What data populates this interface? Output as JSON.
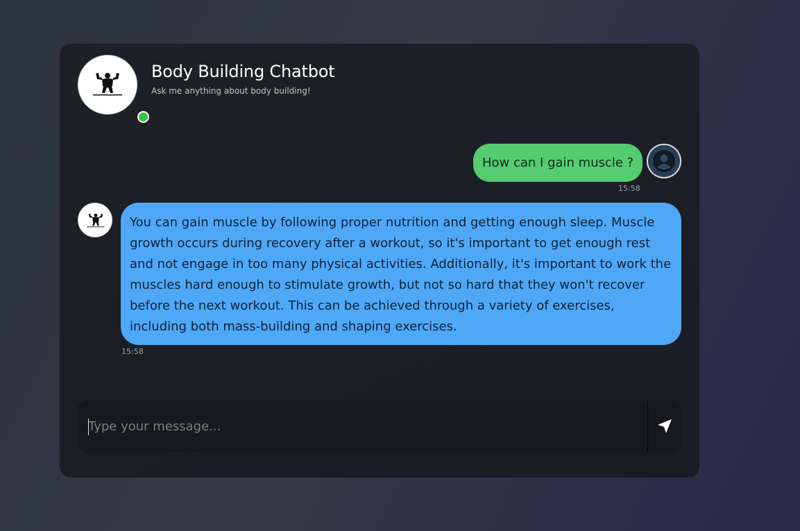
{
  "header": {
    "title": "Body Building Chatbot",
    "subtitle": "Ask me anything about body building!",
    "bot_avatar_icon": "bodybuilder-logo-icon",
    "online_status_color": "#3fc23f"
  },
  "messages": [
    {
      "sender": "user",
      "text": "How can I gain muscle ?",
      "time": "15:58",
      "bubble_color": "#55cc70",
      "avatar_icon": "user-silhouette-icon"
    },
    {
      "sender": "bot",
      "text": "You can gain muscle by following proper nutrition and getting enough sleep. Muscle growth occurs during recovery after a workout, so it's important to get enough rest and not engage in too many physical activities. Additionally, it's important to work the muscles hard enough to stimulate growth, but not so hard that they won't recover before the next workout. This can be achieved through a variety of exercises, including both mass-building and shaping exercises.",
      "time": "15:58",
      "bubble_color": "#4fa8f7",
      "avatar_icon": "bodybuilder-logo-icon"
    }
  ],
  "composer": {
    "placeholder": "Type your message...",
    "value": "",
    "send_icon": "send-arrow-icon"
  }
}
